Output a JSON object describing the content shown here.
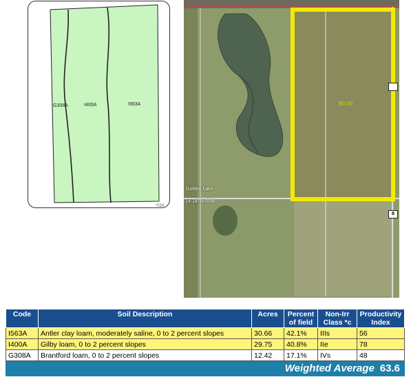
{
  "soil_map": {
    "labels": [
      "G308A",
      "I400A",
      "I563A"
    ],
    "copyright": "©20"
  },
  "aerial": {
    "lake_label": "Golden Lake",
    "plss_label": "14-147N-55W",
    "field_acres": "80.00",
    "road_shield": "8"
  },
  "table": {
    "headers": [
      "Code",
      "Soil Description",
      "Acres",
      "Percent of field",
      "Non-Irr Class *c",
      "Productivity Index"
    ],
    "rows": [
      {
        "code": "I563A",
        "description": "Antler clay loam, moderately saline, 0 to 2 percent slopes",
        "acres": "30.66",
        "percent": "42.1%",
        "class": "IIIs",
        "pi": "56"
      },
      {
        "code": "I400A",
        "description": "Gilby loam, 0 to 2 percent slopes",
        "acres": "29.75",
        "percent": "40.8%",
        "class": "IIe",
        "pi": "78"
      },
      {
        "code": "G308A",
        "description": "Brantford loam, 0 to 2 percent slopes",
        "acres": "12.42",
        "percent": "17.1%",
        "class": "IVs",
        "pi": "48"
      }
    ],
    "weighted_label": "Weighted Average",
    "weighted_value": "63.6"
  },
  "colors": {
    "header_blue": "#1a4f8f",
    "footer_teal": "#1e7fa8",
    "highlight_yellow": "#fff47a",
    "soil_green": "#c8f5c0",
    "field_outline": "#f2ea00"
  }
}
